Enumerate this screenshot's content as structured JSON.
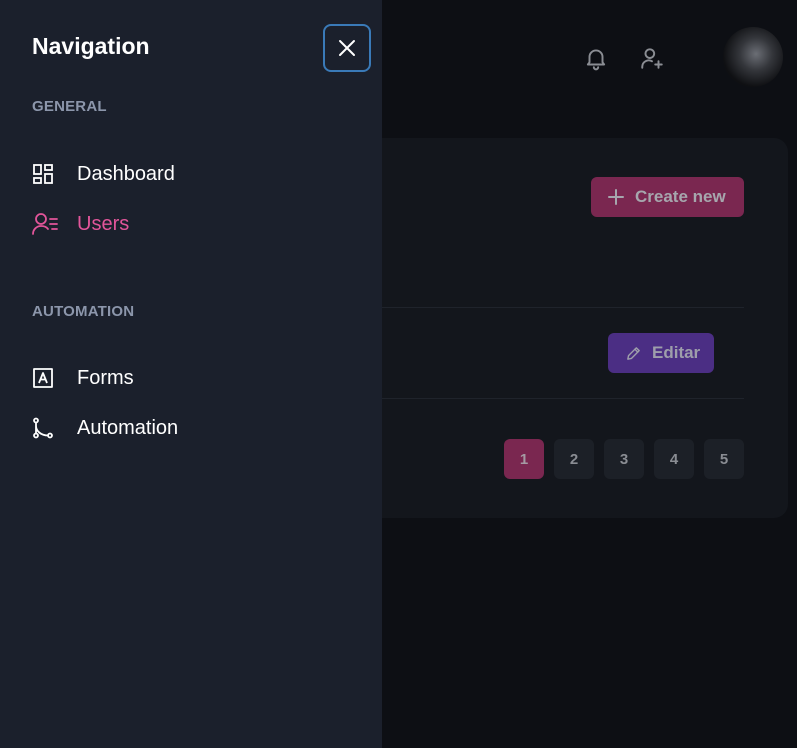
{
  "drawer": {
    "title": "Navigation",
    "sections": [
      {
        "label": "GENERAL",
        "items": [
          {
            "label": "Dashboard",
            "icon": "dashboard-icon",
            "active": false
          },
          {
            "label": "Users",
            "icon": "users-list-icon",
            "active": true
          }
        ]
      },
      {
        "label": "AUTOMATION",
        "items": [
          {
            "label": "Forms",
            "icon": "forms-icon",
            "active": false
          },
          {
            "label": "Automation",
            "icon": "branch-icon",
            "active": false
          }
        ]
      }
    ]
  },
  "header": {
    "icons": [
      "bell-icon",
      "user-plus-icon"
    ]
  },
  "content": {
    "create_label": "Create new",
    "edit_label": "Editar",
    "pagination": [
      "1",
      "2",
      "3",
      "4",
      "5"
    ],
    "current_page": "1"
  },
  "colors": {
    "drawer_bg": "#1b202c",
    "accent_pink": "#e2559a",
    "close_border": "#3a7ab8",
    "create_bg": "#7a2750",
    "edit_bg": "#4b2e84"
  }
}
